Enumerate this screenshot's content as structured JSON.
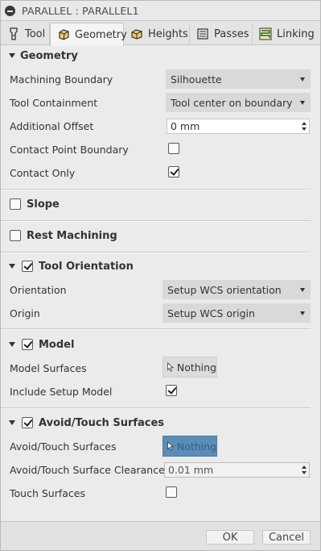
{
  "window": {
    "title": "PARALLEL : PARALLEL1"
  },
  "tabs": [
    {
      "label": "Tool",
      "icon": "tool-icon"
    },
    {
      "label": "Geometry",
      "icon": "geometry-icon",
      "active": true
    },
    {
      "label": "Heights",
      "icon": "heights-icon"
    },
    {
      "label": "Passes",
      "icon": "passes-icon"
    },
    {
      "label": "Linking",
      "icon": "linking-icon"
    }
  ],
  "geometry": {
    "heading": "Geometry",
    "machining_boundary": {
      "label": "Machining Boundary",
      "value": "Silhouette"
    },
    "tool_containment": {
      "label": "Tool Containment",
      "value": "Tool center on boundary"
    },
    "additional_offset": {
      "label": "Additional Offset",
      "value": "0 mm"
    },
    "contact_point_boundary": {
      "label": "Contact Point Boundary",
      "checked": false
    },
    "contact_only": {
      "label": "Contact Only",
      "checked": true
    }
  },
  "slope": {
    "heading": "Slope",
    "checked": false
  },
  "rest_machining": {
    "heading": "Rest Machining",
    "checked": false
  },
  "tool_orientation": {
    "heading": "Tool Orientation",
    "checked": true,
    "orientation": {
      "label": "Orientation",
      "value": "Setup WCS orientation"
    },
    "origin": {
      "label": "Origin",
      "value": "Setup WCS origin"
    }
  },
  "model": {
    "heading": "Model",
    "checked": true,
    "model_surfaces": {
      "label": "Model Surfaces",
      "value": "Nothing"
    },
    "include_setup_model": {
      "label": "Include Setup Model",
      "checked": true
    }
  },
  "avoid_touch": {
    "heading": "Avoid/Touch Surfaces",
    "checked": true,
    "surfaces": {
      "label": "Avoid/Touch Surfaces",
      "value": "Nothing"
    },
    "clearance": {
      "label": "Avoid/Touch Surface Clearance",
      "value": "0.01 mm"
    },
    "touch_surfaces": {
      "label": "Touch Surfaces",
      "checked": false
    }
  },
  "footer": {
    "ok": "OK",
    "cancel": "Cancel"
  },
  "colors": {
    "selection_active": "#5b8db8",
    "panel": "#ebebeb"
  }
}
